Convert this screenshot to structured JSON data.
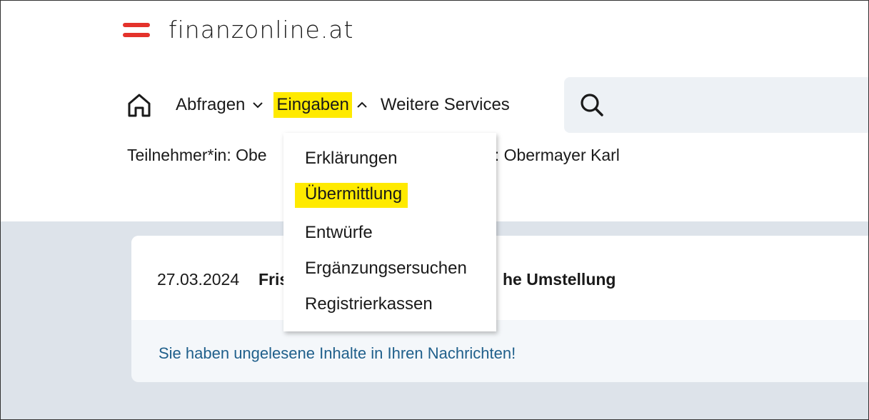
{
  "header": {
    "logo_text": "finanzonline.at"
  },
  "nav": {
    "items": [
      {
        "label": "Abfragen",
        "expanded": false,
        "highlighted": false
      },
      {
        "label": "Eingaben",
        "expanded": true,
        "highlighted": true
      },
      {
        "label": "Weitere Services"
      }
    ]
  },
  "participant": {
    "left_text": "Teilnehmer*in: Obe",
    "right_text": "n: Obermayer Karl"
  },
  "dropdown": {
    "items": [
      "Erklärungen",
      "Übermittlung",
      "Entwürfe",
      "Ergänzungsersuchen",
      "Registrierkassen"
    ],
    "highlighted_item": "Übermittlung"
  },
  "news": {
    "date": "27.03.2024",
    "title_start": "Fris",
    "title_end": "he Umstellung",
    "unread_notice": "Sie haben ungelesene Inhalte in Ihren Nachrichten!"
  },
  "colors": {
    "brand_red": "#e4322b",
    "highlight": "#ffea00",
    "link": "#1f5f8b",
    "grey_bg": "#dde3ea"
  }
}
